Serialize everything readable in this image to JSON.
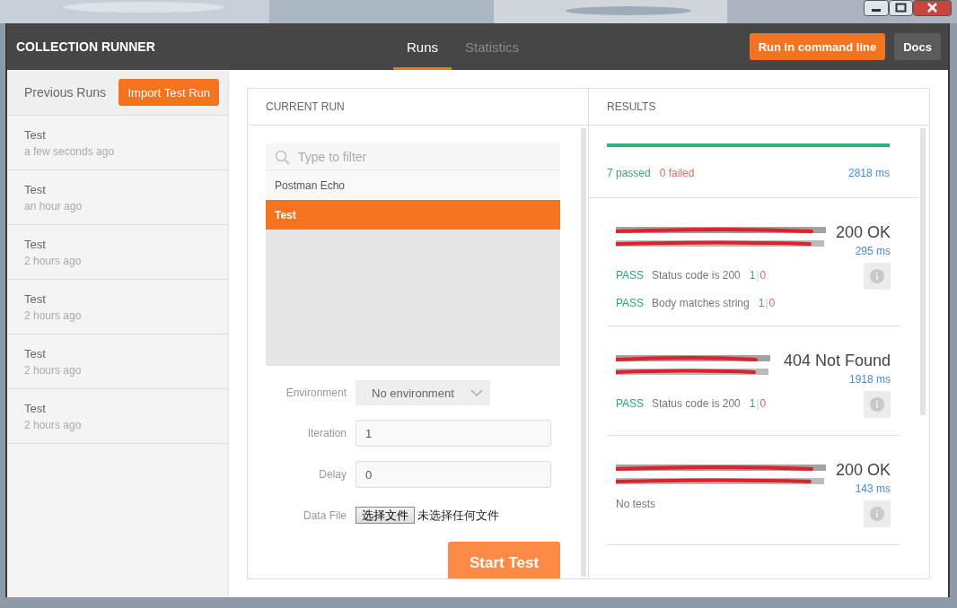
{
  "header": {
    "title": "COLLECTION RUNNER",
    "tabs": [
      {
        "label": "Runs",
        "selected": true
      },
      {
        "label": "Statistics",
        "selected": false
      }
    ],
    "buttons": [
      {
        "label": "Run in command line",
        "kind": "primary"
      },
      {
        "label": "Docs",
        "kind": "secondary"
      }
    ]
  },
  "sidebar": {
    "title": "Previous Runs",
    "import_button": "Import Test Run",
    "runs": [
      {
        "name": "Test",
        "time": "a few seconds ago"
      },
      {
        "name": "Test",
        "time": "an hour ago"
      },
      {
        "name": "Test",
        "time": "2 hours ago"
      },
      {
        "name": "Test",
        "time": "2 hours ago"
      },
      {
        "name": "Test",
        "time": "2 hours ago"
      },
      {
        "name": "Test",
        "time": "2 hours ago"
      }
    ]
  },
  "current_run": {
    "heading": "CURRENT RUN",
    "filter": {
      "placeholder": "Type to filter"
    },
    "collections": [
      {
        "label": "Postman Echo",
        "selected": false
      },
      {
        "label": "Test",
        "selected": true
      }
    ],
    "environment": {
      "label": "Environment",
      "value": "No environment"
    },
    "iteration": {
      "label": "Iteration",
      "value": "1"
    },
    "delay": {
      "label": "Delay",
      "value": "0"
    },
    "data_file": {
      "label": "Data File",
      "button": "选择文件",
      "status": "未选择任何文件"
    },
    "start_button": "Start Test"
  },
  "results": {
    "heading": "RESULTS",
    "progress": {
      "level": 1
    },
    "passed": "7 passed",
    "failed": "0 failed",
    "total_time": "2818 ms",
    "requests": [
      {
        "status": "200 OK",
        "time": "295 ms",
        "tests": [
          {
            "result": "PASS",
            "name": "Status code is 200",
            "pass_count": "1",
            "separator": "|",
            "fail_count": "0"
          },
          {
            "result": "PASS",
            "name": "Body matches string",
            "pass_count": "1",
            "separator": "|",
            "fail_count": "0"
          }
        ]
      },
      {
        "status": "404 Not Found",
        "time": "1918 ms",
        "tests": [
          {
            "result": "PASS",
            "name": "Status code is 200",
            "pass_count": "1",
            "separator": "|",
            "fail_count": "0"
          }
        ]
      },
      {
        "status": "200 OK",
        "time": "143 ms",
        "no_tests": "No tests"
      }
    ]
  }
}
